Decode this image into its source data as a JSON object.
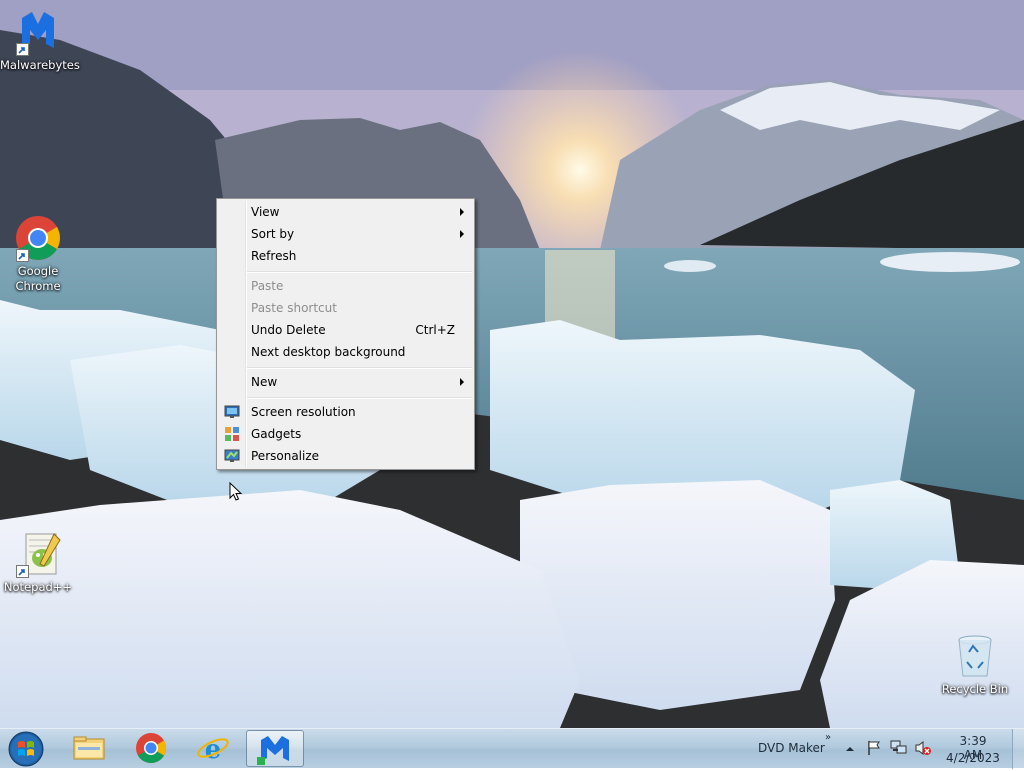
{
  "desktop": {
    "icons": [
      {
        "label": "Malwarebytes"
      },
      {
        "label": "Google Chrome"
      },
      {
        "label": "Notepad++"
      },
      {
        "label": "Recycle Bin"
      }
    ]
  },
  "context_menu": {
    "items": [
      {
        "label": "View",
        "submenu": true
      },
      {
        "label": "Sort by",
        "submenu": true
      },
      {
        "label": "Refresh"
      },
      {
        "label": "Paste",
        "disabled": true
      },
      {
        "label": "Paste shortcut",
        "disabled": true
      },
      {
        "label": "Undo Delete",
        "shortcut": "Ctrl+Z"
      },
      {
        "label": "Next desktop background"
      },
      {
        "label": "New",
        "submenu": true
      },
      {
        "label": "Screen resolution",
        "icon": "screen-resolution-icon"
      },
      {
        "label": "Gadgets",
        "icon": "gadgets-icon"
      },
      {
        "label": "Personalize",
        "icon": "personalize-icon"
      }
    ]
  },
  "taskbar": {
    "toolbar_label": "DVD Maker",
    "toolbar_chevron": "»",
    "clock": {
      "time": "3:39 AM",
      "date": "4/2/2023"
    },
    "pinned": [
      "windows-explorer-icon",
      "google-chrome-icon",
      "internet-explorer-icon",
      "malwarebytes-icon"
    ]
  },
  "colors": {
    "menu_bg": "#f0f0f0",
    "menu_border": "#979797",
    "disabled_text": "#8d8d8d",
    "taskbar": "#b2cade"
  }
}
